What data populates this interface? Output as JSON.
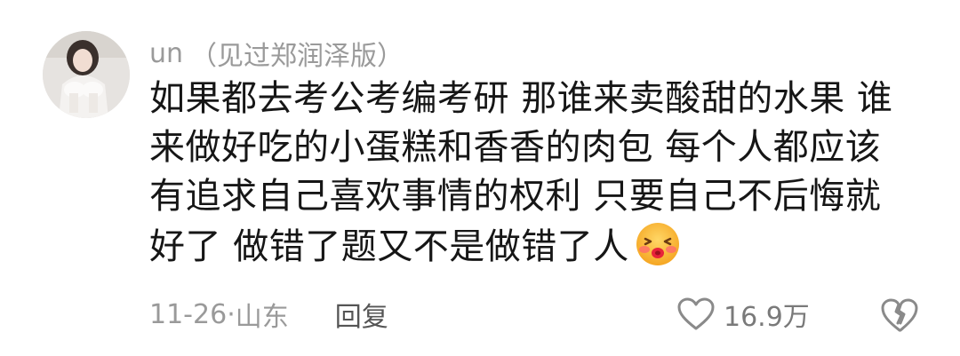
{
  "comment": {
    "username": "un",
    "username_tag": "（见过郑润泽版）",
    "text_lines": [
      "如果都去考公考编考研 那谁来卖酸甜的水果 谁",
      "来做好吃的小蛋糕和香香的肉包 每个人都应该",
      "有追求自己喜欢事情的权利 只要自己不后悔就",
      "好了 做错了题又不是做错了人"
    ],
    "emoji": "blush-kiss-emoji",
    "date": "11-26",
    "separator": "·",
    "location": "山东",
    "reply_label": "回复",
    "like_count": "16.9万",
    "like_icon": "heart-icon",
    "dislike_icon": "broken-heart-icon"
  },
  "colors": {
    "text": "#161616",
    "secondary": "#9a9a9a",
    "reply": "#555555",
    "icon": "#8a8a8a"
  }
}
